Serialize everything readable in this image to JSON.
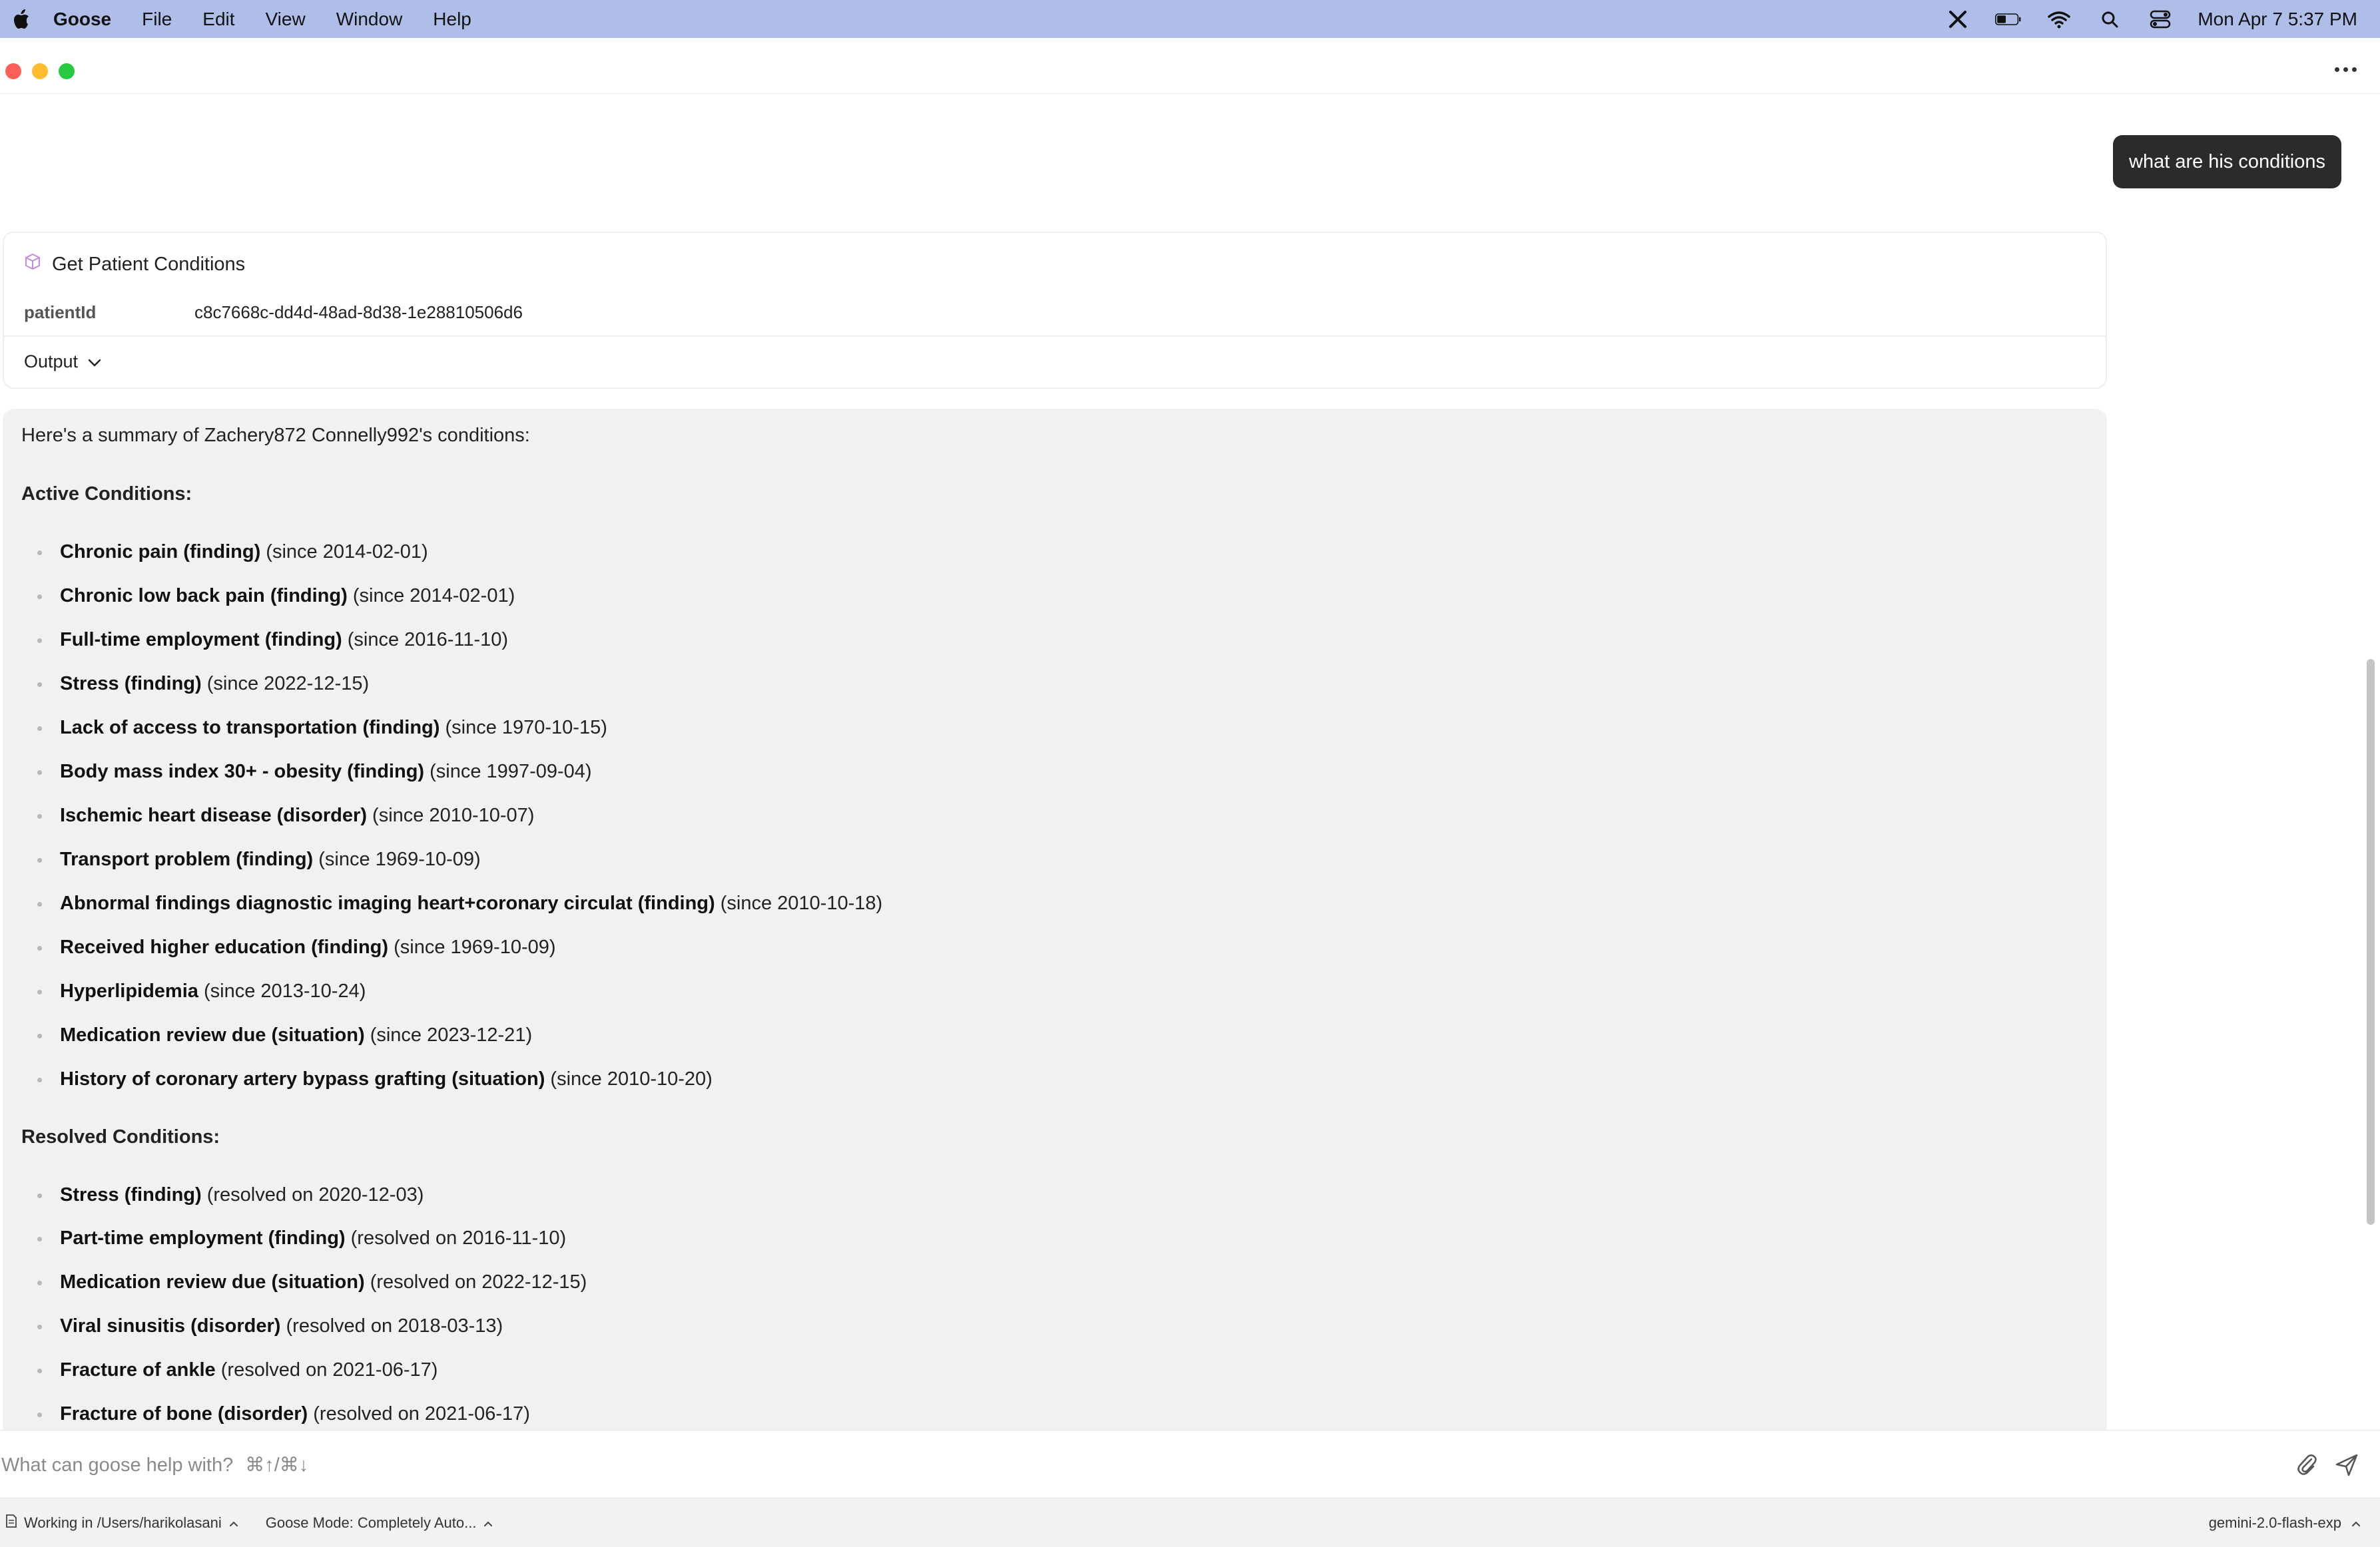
{
  "menubar": {
    "app_name": "Goose",
    "menus": [
      "File",
      "Edit",
      "View",
      "Window",
      "Help"
    ],
    "clock": "Mon Apr 7  5:37 PM",
    "status_icons": [
      "x-icon",
      "battery-icon",
      "wifi-icon",
      "search-icon",
      "control-center-icon"
    ]
  },
  "chat": {
    "user_message": "what are his conditions",
    "tool_call": {
      "title": "Get Patient Conditions",
      "param_key": "patientId",
      "param_value": "c8c7668c-dd4d-48ad-8d38-1e28810506d6",
      "output_label": "Output"
    },
    "response": {
      "intro": "Here's a summary of Zachery872 Connelly992's conditions:",
      "active_heading": "Active Conditions:",
      "active": [
        {
          "name": "Chronic pain (finding)",
          "detail": "(since 2014-02-01)"
        },
        {
          "name": "Chronic low back pain (finding)",
          "detail": "(since 2014-02-01)"
        },
        {
          "name": "Full-time employment (finding)",
          "detail": "(since 2016-11-10)"
        },
        {
          "name": "Stress (finding)",
          "detail": "(since 2022-12-15)"
        },
        {
          "name": "Lack of access to transportation (finding)",
          "detail": "(since 1970-10-15)"
        },
        {
          "name": "Body mass index 30+ - obesity (finding)",
          "detail": "(since 1997-09-04)"
        },
        {
          "name": "Ischemic heart disease (disorder)",
          "detail": "(since 2010-10-07)"
        },
        {
          "name": "Transport problem (finding)",
          "detail": "(since 1969-10-09)"
        },
        {
          "name": "Abnormal findings diagnostic imaging heart+coronary circulat (finding)",
          "detail": "(since 2010-10-18)"
        },
        {
          "name": "Received higher education (finding)",
          "detail": "(since 1969-10-09)"
        },
        {
          "name": "Hyperlipidemia",
          "detail": "(since 2013-10-24)"
        },
        {
          "name": "Medication review due (situation)",
          "detail": "(since 2023-12-21)"
        },
        {
          "name": "History of coronary artery bypass grafting (situation)",
          "detail": "(since 2010-10-20)"
        }
      ],
      "resolved_heading": "Resolved Conditions:",
      "resolved": [
        {
          "name": "Stress (finding)",
          "detail": "(resolved on 2020-12-03)"
        },
        {
          "name": "Part-time employment (finding)",
          "detail": "(resolved on 2016-11-10)"
        },
        {
          "name": "Medication review due (situation)",
          "detail": "(resolved on 2022-12-15)"
        },
        {
          "name": "Viral sinusitis (disorder)",
          "detail": "(resolved on 2018-03-13)"
        },
        {
          "name": "Fracture of ankle",
          "detail": "(resolved on 2021-06-17)"
        },
        {
          "name": "Fracture of bone (disorder)",
          "detail": "(resolved on 2021-06-17)"
        }
      ]
    }
  },
  "input": {
    "placeholder": "What can goose help with?",
    "shortcut_hint": "⌘↑/⌘↓"
  },
  "status": {
    "working_dir": "Working in /Users/harikolasani",
    "mode": "Goose Mode: Completely Auto...",
    "model": "gemini-2.0-flash-exp"
  },
  "colors": {
    "menubar_bg": "#afbde9",
    "user_bubble_bg": "#2b2b2b",
    "response_bg": "#f1f1f1"
  }
}
